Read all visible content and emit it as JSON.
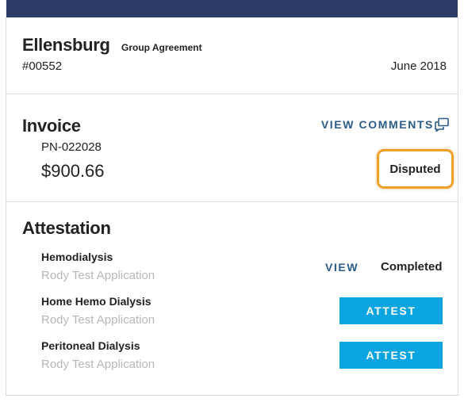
{
  "group": {
    "name": "Ellensburg",
    "type": "Group Agreement",
    "id": "#00552",
    "date": "June 2018"
  },
  "invoice": {
    "title": "Invoice",
    "view_comments_label": "VIEW COMMENTS",
    "number": "PN-022028",
    "amount": "$900.66",
    "status": "Disputed",
    "status_highlight_color": "#f0a02a"
  },
  "attestation": {
    "title": "Attestation",
    "items": [
      {
        "name": "Hemodialysis",
        "application": "Rody Test Application",
        "view_label": "VIEW",
        "status": "Completed"
      },
      {
        "name": "Home Hemo Dialysis",
        "application": "Rody Test Application",
        "action_label": "ATTEST"
      },
      {
        "name": "Peritoneal Dialysis",
        "application": "Rody Test Application",
        "action_label": "ATTEST"
      }
    ]
  },
  "colors": {
    "top_bar": "#2b3a67",
    "link": "#2b5c8a",
    "attest_button": "#0aa5e0",
    "muted_text": "#b8b8b8"
  },
  "icons": {
    "comments": "external-comments-icon"
  }
}
